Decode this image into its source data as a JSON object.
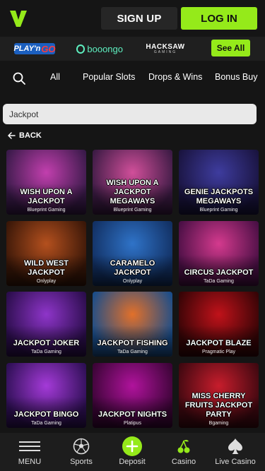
{
  "header": {
    "logo_letter": "V",
    "signup_label": "SIGN UP",
    "login_label": "LOG IN",
    "accent": "#95ea1a"
  },
  "providers": {
    "playngo": {
      "text1": "PLAY'n",
      "text2": "GO"
    },
    "booongo": "booongo",
    "hacksaw": {
      "text1": "HACKSAW",
      "text2": "GAMING"
    },
    "see_all_label": "See All"
  },
  "tabs": [
    "All",
    "Popular Slots",
    "Drops & Wins",
    "Bonus Buy"
  ],
  "search": {
    "value": "Jackpot"
  },
  "back_label": "BACK",
  "games": [
    {
      "title": "Wish Upon a Jackpot",
      "provider": "Blueprint Gaming",
      "c1": "#c23fae",
      "c2": "#3a1a4a"
    },
    {
      "title": "Wish Upon a Jackpot Megaways",
      "provider": "Blueprint Gaming",
      "c1": "#d14f9a",
      "c2": "#3d1b45"
    },
    {
      "title": "Genie Jackpots Megaways",
      "provider": "Blueprint Gaming",
      "c1": "#3e3c9e",
      "c2": "#1a1440"
    },
    {
      "title": "Wild West Jackpot",
      "provider": "Onlyplay",
      "c1": "#b4501e",
      "c2": "#3a1708"
    },
    {
      "title": "Caramelo Jackpot",
      "provider": "Onlyplay",
      "c1": "#2f73c8",
      "c2": "#123063"
    },
    {
      "title": "Circus Jackpot",
      "provider": "TaDa Gaming",
      "c1": "#d43a8e",
      "c2": "#4a0f45"
    },
    {
      "title": "Jackpot Joker",
      "provider": "TaDa Gaming",
      "c1": "#8e35c9",
      "c2": "#2b0d4c"
    },
    {
      "title": "Jackpot Fishing",
      "provider": "TaDa Gaming",
      "c1": "#e2702a",
      "c2": "#1a4d8a"
    },
    {
      "title": "Jackpot Blaze",
      "provider": "Pragmatic Play",
      "c1": "#c0121a",
      "c2": "#360406"
    },
    {
      "title": "Jackpot Bingo",
      "provider": "TaDa Gaming",
      "c1": "#a43ad8",
      "c2": "#2e0f55"
    },
    {
      "title": "Jackpot Nights",
      "provider": "Platipus",
      "c1": "#b0139c",
      "c2": "#3b0436"
    },
    {
      "title": "Miss Cherry Fruits Jackpot Party",
      "provider": "Bgaming",
      "c1": "#c71d2c",
      "c2": "#3f0810"
    }
  ],
  "bottom_nav": [
    {
      "label": "MENU",
      "icon": "hamburger-icon"
    },
    {
      "label": "Sports",
      "icon": "soccer-ball-icon"
    },
    {
      "label": "Deposit",
      "icon": "plus-icon"
    },
    {
      "label": "Casino",
      "icon": "cherry-icon"
    },
    {
      "label": "Live Casino",
      "icon": "spade-icon"
    }
  ]
}
